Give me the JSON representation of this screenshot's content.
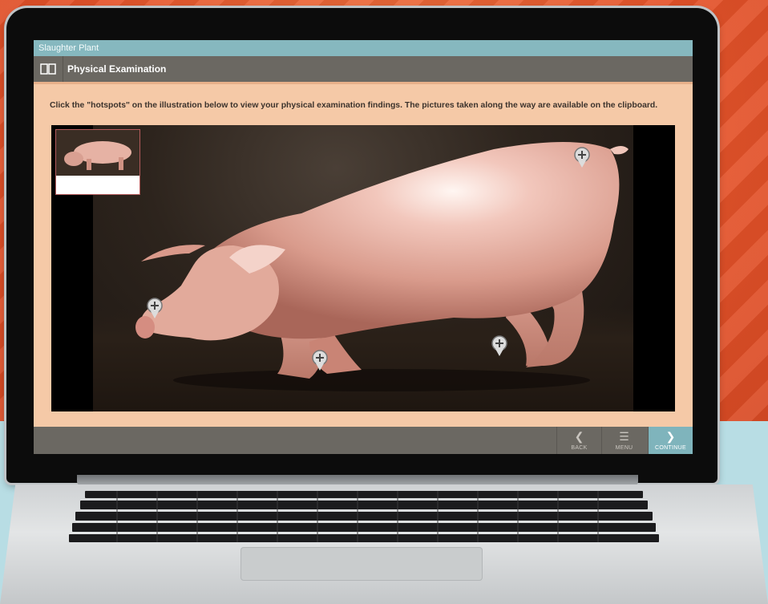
{
  "app": {
    "title": "Slaughter Plant"
  },
  "header": {
    "title": "Physical Examination",
    "icon": "book-icon"
  },
  "instruction": "Click the \"hotspots\" on the illustration below to view your physical examination findings. The pictures taken along the way are available on the clipboard.",
  "illustration": {
    "subject": "pig",
    "hotspots": [
      {
        "name": "hotspot-snout"
      },
      {
        "name": "hotspot-front-hoof"
      },
      {
        "name": "hotspot-rear-hoof"
      },
      {
        "name": "hotspot-tail"
      }
    ]
  },
  "footer": {
    "back_label": "BACK",
    "menu_label": "MENU",
    "continue_label": "CONTINUE"
  },
  "colors": {
    "title_strip": "#86b8bf",
    "header_bar": "#6b6862",
    "content_bg": "#f5c9a7",
    "continue_button": "#7fb4bc"
  }
}
